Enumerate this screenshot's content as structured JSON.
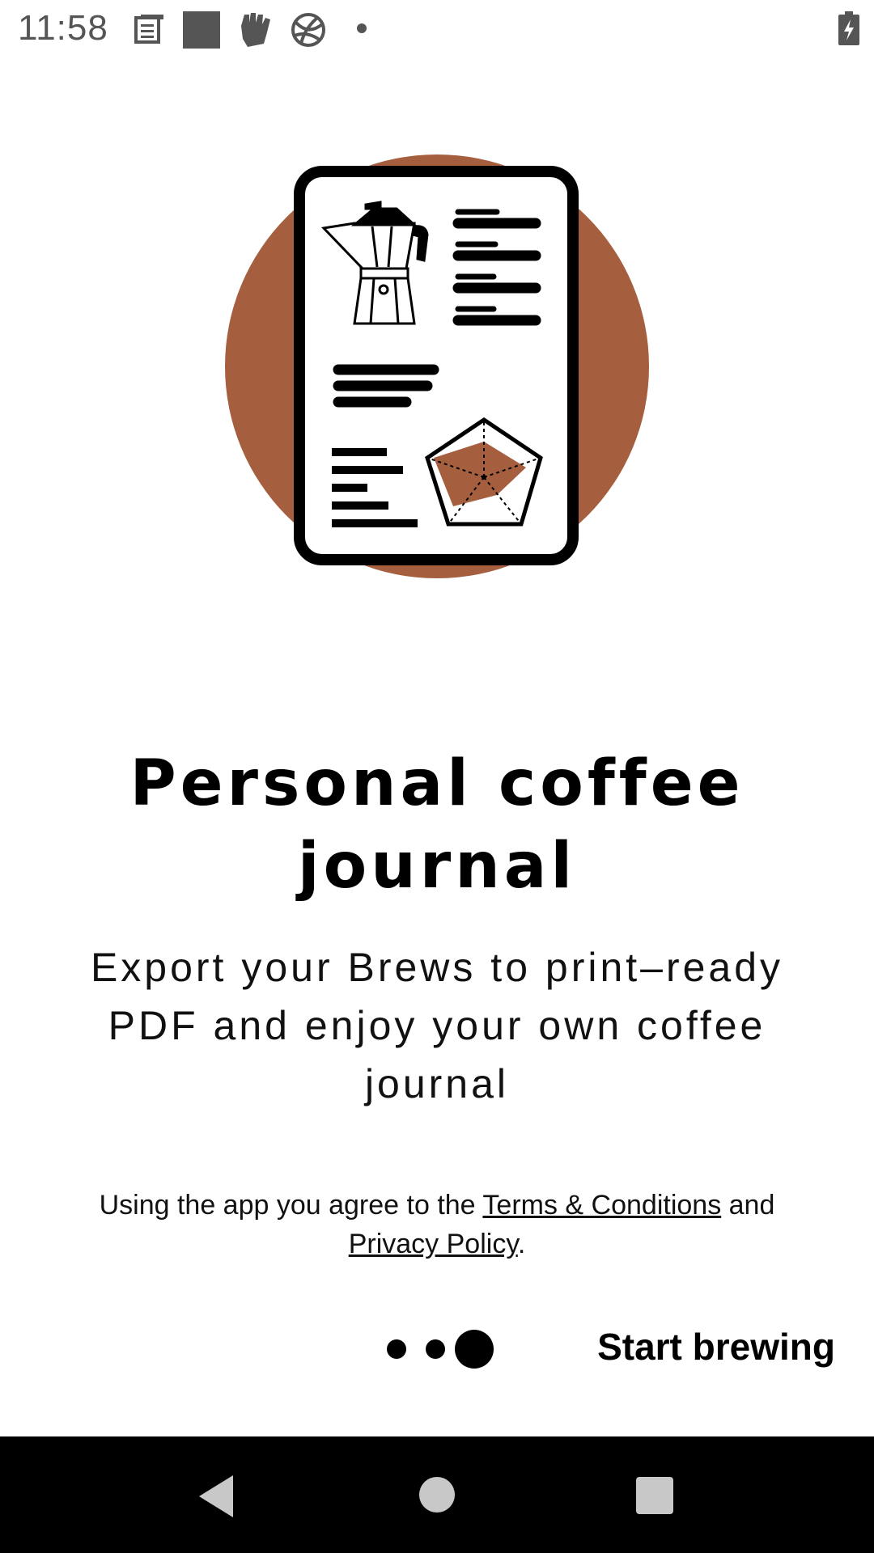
{
  "status_bar": {
    "time": "11:58",
    "icons": [
      "notification-doc-icon",
      "square-icon",
      "fist-icon",
      "globe-icon",
      "dot-icon"
    ],
    "battery_icon": "battery-charging-icon"
  },
  "illustration": {
    "icons": [
      "coffee-journal-page-icon",
      "moka-pot-icon",
      "flavor-radar-icon"
    ],
    "accent_color": "#A65F3E"
  },
  "onboarding": {
    "title": "Personal coffee journal",
    "subtitle": "Export your Brews to print–ready PDF and enjoy your own coffee journal"
  },
  "legal": {
    "prefix": "Using the app you agree to the ",
    "terms_link": "Terms & Conditions",
    "middle": " and ",
    "privacy_link": "Privacy Policy",
    "suffix": "."
  },
  "pager": {
    "total": 3,
    "current": 3
  },
  "start_button": {
    "label": "Start brewing"
  },
  "nav_bar": {
    "icons": [
      "back-icon",
      "home-icon",
      "recents-icon"
    ]
  }
}
